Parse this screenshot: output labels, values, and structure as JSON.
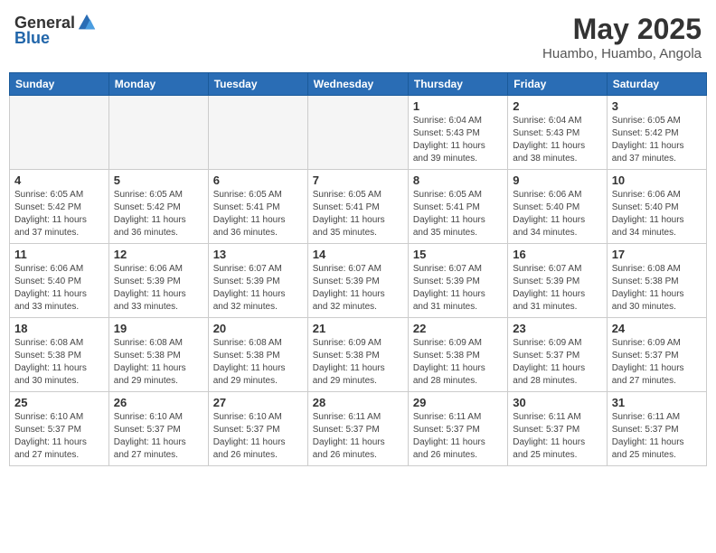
{
  "header": {
    "logo_general": "General",
    "logo_blue": "Blue",
    "month_title": "May 2025",
    "location": "Huambo, Huambo, Angola"
  },
  "weekdays": [
    "Sunday",
    "Monday",
    "Tuesday",
    "Wednesday",
    "Thursday",
    "Friday",
    "Saturday"
  ],
  "weeks": [
    [
      {
        "day": "",
        "info": ""
      },
      {
        "day": "",
        "info": ""
      },
      {
        "day": "",
        "info": ""
      },
      {
        "day": "",
        "info": ""
      },
      {
        "day": "1",
        "info": "Sunrise: 6:04 AM\nSunset: 5:43 PM\nDaylight: 11 hours\nand 39 minutes."
      },
      {
        "day": "2",
        "info": "Sunrise: 6:04 AM\nSunset: 5:43 PM\nDaylight: 11 hours\nand 38 minutes."
      },
      {
        "day": "3",
        "info": "Sunrise: 6:05 AM\nSunset: 5:42 PM\nDaylight: 11 hours\nand 37 minutes."
      }
    ],
    [
      {
        "day": "4",
        "info": "Sunrise: 6:05 AM\nSunset: 5:42 PM\nDaylight: 11 hours\nand 37 minutes."
      },
      {
        "day": "5",
        "info": "Sunrise: 6:05 AM\nSunset: 5:42 PM\nDaylight: 11 hours\nand 36 minutes."
      },
      {
        "day": "6",
        "info": "Sunrise: 6:05 AM\nSunset: 5:41 PM\nDaylight: 11 hours\nand 36 minutes."
      },
      {
        "day": "7",
        "info": "Sunrise: 6:05 AM\nSunset: 5:41 PM\nDaylight: 11 hours\nand 35 minutes."
      },
      {
        "day": "8",
        "info": "Sunrise: 6:05 AM\nSunset: 5:41 PM\nDaylight: 11 hours\nand 35 minutes."
      },
      {
        "day": "9",
        "info": "Sunrise: 6:06 AM\nSunset: 5:40 PM\nDaylight: 11 hours\nand 34 minutes."
      },
      {
        "day": "10",
        "info": "Sunrise: 6:06 AM\nSunset: 5:40 PM\nDaylight: 11 hours\nand 34 minutes."
      }
    ],
    [
      {
        "day": "11",
        "info": "Sunrise: 6:06 AM\nSunset: 5:40 PM\nDaylight: 11 hours\nand 33 minutes."
      },
      {
        "day": "12",
        "info": "Sunrise: 6:06 AM\nSunset: 5:39 PM\nDaylight: 11 hours\nand 33 minutes."
      },
      {
        "day": "13",
        "info": "Sunrise: 6:07 AM\nSunset: 5:39 PM\nDaylight: 11 hours\nand 32 minutes."
      },
      {
        "day": "14",
        "info": "Sunrise: 6:07 AM\nSunset: 5:39 PM\nDaylight: 11 hours\nand 32 minutes."
      },
      {
        "day": "15",
        "info": "Sunrise: 6:07 AM\nSunset: 5:39 PM\nDaylight: 11 hours\nand 31 minutes."
      },
      {
        "day": "16",
        "info": "Sunrise: 6:07 AM\nSunset: 5:39 PM\nDaylight: 11 hours\nand 31 minutes."
      },
      {
        "day": "17",
        "info": "Sunrise: 6:08 AM\nSunset: 5:38 PM\nDaylight: 11 hours\nand 30 minutes."
      }
    ],
    [
      {
        "day": "18",
        "info": "Sunrise: 6:08 AM\nSunset: 5:38 PM\nDaylight: 11 hours\nand 30 minutes."
      },
      {
        "day": "19",
        "info": "Sunrise: 6:08 AM\nSunset: 5:38 PM\nDaylight: 11 hours\nand 29 minutes."
      },
      {
        "day": "20",
        "info": "Sunrise: 6:08 AM\nSunset: 5:38 PM\nDaylight: 11 hours\nand 29 minutes."
      },
      {
        "day": "21",
        "info": "Sunrise: 6:09 AM\nSunset: 5:38 PM\nDaylight: 11 hours\nand 29 minutes."
      },
      {
        "day": "22",
        "info": "Sunrise: 6:09 AM\nSunset: 5:38 PM\nDaylight: 11 hours\nand 28 minutes."
      },
      {
        "day": "23",
        "info": "Sunrise: 6:09 AM\nSunset: 5:37 PM\nDaylight: 11 hours\nand 28 minutes."
      },
      {
        "day": "24",
        "info": "Sunrise: 6:09 AM\nSunset: 5:37 PM\nDaylight: 11 hours\nand 27 minutes."
      }
    ],
    [
      {
        "day": "25",
        "info": "Sunrise: 6:10 AM\nSunset: 5:37 PM\nDaylight: 11 hours\nand 27 minutes."
      },
      {
        "day": "26",
        "info": "Sunrise: 6:10 AM\nSunset: 5:37 PM\nDaylight: 11 hours\nand 27 minutes."
      },
      {
        "day": "27",
        "info": "Sunrise: 6:10 AM\nSunset: 5:37 PM\nDaylight: 11 hours\nand 26 minutes."
      },
      {
        "day": "28",
        "info": "Sunrise: 6:11 AM\nSunset: 5:37 PM\nDaylight: 11 hours\nand 26 minutes."
      },
      {
        "day": "29",
        "info": "Sunrise: 6:11 AM\nSunset: 5:37 PM\nDaylight: 11 hours\nand 26 minutes."
      },
      {
        "day": "30",
        "info": "Sunrise: 6:11 AM\nSunset: 5:37 PM\nDaylight: 11 hours\nand 25 minutes."
      },
      {
        "day": "31",
        "info": "Sunrise: 6:11 AM\nSunset: 5:37 PM\nDaylight: 11 hours\nand 25 minutes."
      }
    ]
  ]
}
